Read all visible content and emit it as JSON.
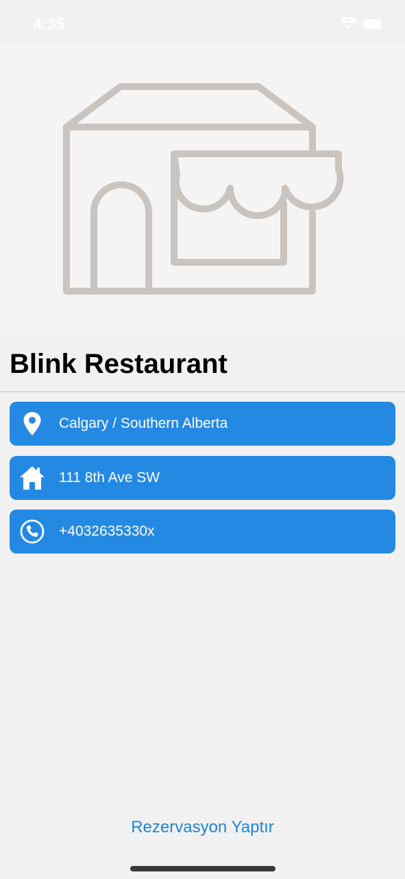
{
  "status_bar": {
    "time": "4:35",
    "icons": [
      "wifi-icon",
      "battery-icon"
    ]
  },
  "hero": {
    "icon": "storefront-icon",
    "icon_color": "#c9c4bf",
    "background": "#f4f4f4"
  },
  "restaurant": {
    "name": "Blink Restaurant"
  },
  "info_rows": [
    {
      "icon": "location-pin-icon",
      "text": "Calgary / Southern Alberta"
    },
    {
      "icon": "home-icon",
      "text": "111 8th Ave SW"
    },
    {
      "icon": "phone-icon",
      "text": "+4032635330x"
    }
  ],
  "actions": {
    "reserve_label": "Rezervasyon Yaptır"
  },
  "colors": {
    "accent": "#2489e3",
    "link": "#1d84d6",
    "background": "#f1f1f1"
  }
}
